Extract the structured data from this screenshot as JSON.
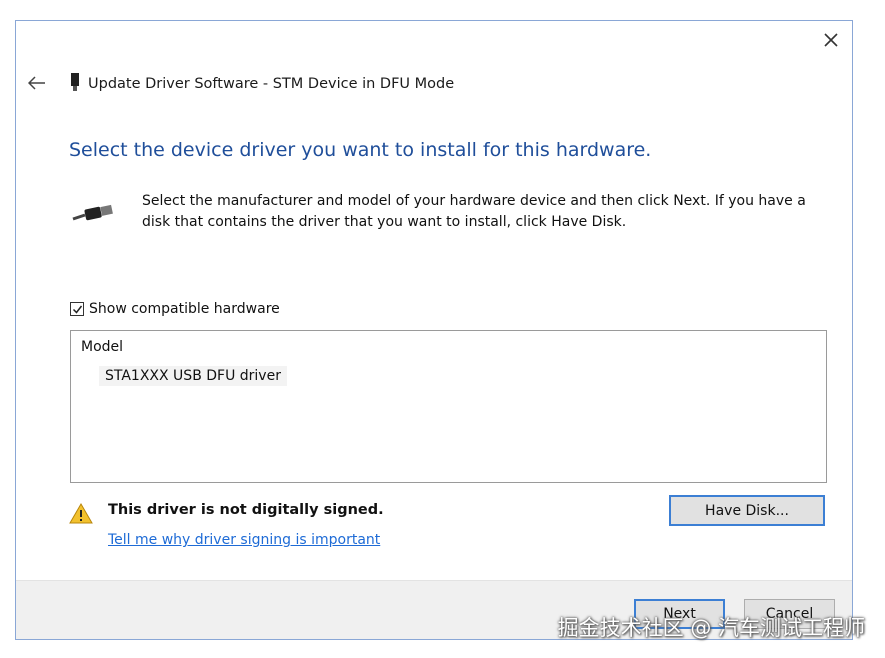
{
  "window": {
    "title": "Update Driver Software - STM Device in DFU Mode",
    "close_icon": "close-icon",
    "back_icon": "back-arrow-icon"
  },
  "main": {
    "heading": "Select the device driver you want to install for this hardware.",
    "description": "Select the manufacturer and model of your hardware device and then click Next. If you have a disk that contains the driver that you want to install, click Have Disk.",
    "show_compatible_label": "Show compatible hardware",
    "show_compatible_checked": true,
    "model_header": "Model",
    "models": [
      "STA1XXX USB DFU driver"
    ],
    "warning_text": "This driver is not digitally signed.",
    "warning_link": "Tell me why driver signing is important",
    "have_disk_label": "Have Disk..."
  },
  "footer": {
    "next_label": "Next",
    "cancel_label": "Cancel"
  },
  "watermark": "掘金技术社区 @ 汽车测试工程师",
  "colors": {
    "heading": "#1f4e9a",
    "link": "#1e6bd6",
    "focus_border": "#3c7fd4",
    "footer_bg": "#f0f0f0",
    "warning": "#f2c12e"
  }
}
